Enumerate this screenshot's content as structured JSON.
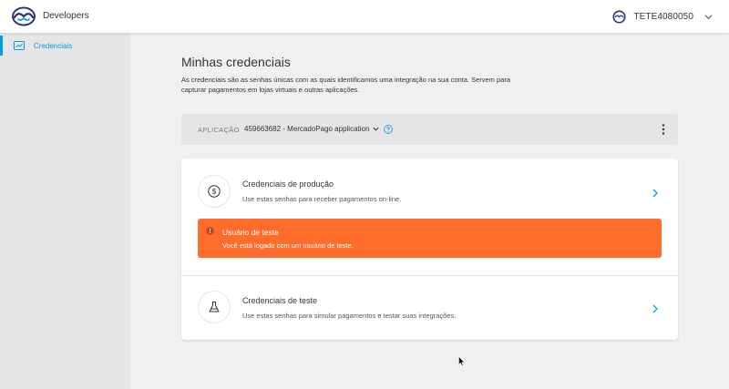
{
  "header": {
    "brand": "Developers",
    "username": "TETE4080050"
  },
  "sidebar": {
    "items": [
      {
        "label": "Credenciais",
        "icon": "chart-card-icon",
        "active": true
      }
    ]
  },
  "main": {
    "title": "Minhas credenciais",
    "description": "As credenciais são as senhas únicas com as quais identificamos uma integração na sua conta. Servem para capturar pagamentos em lojas virtuais e outras aplicações.",
    "application": {
      "label": "APLICAÇÃO",
      "value": "459663682 - MercadoPago application"
    },
    "production": {
      "title": "Credenciais de produção",
      "subtitle": "Use estas senhas para receber pagamentos on-line."
    },
    "alert": {
      "title": "Usuário de teste",
      "message": "Você está logado com um usuário de teste."
    },
    "test": {
      "title": "Credenciais de teste",
      "subtitle": "Use estas senhas para simular pagamentos e testar suas integrações."
    }
  },
  "colors": {
    "accent": "#009ee3",
    "alert": "#ff6c2c",
    "brand_blue": "#2d3277"
  }
}
